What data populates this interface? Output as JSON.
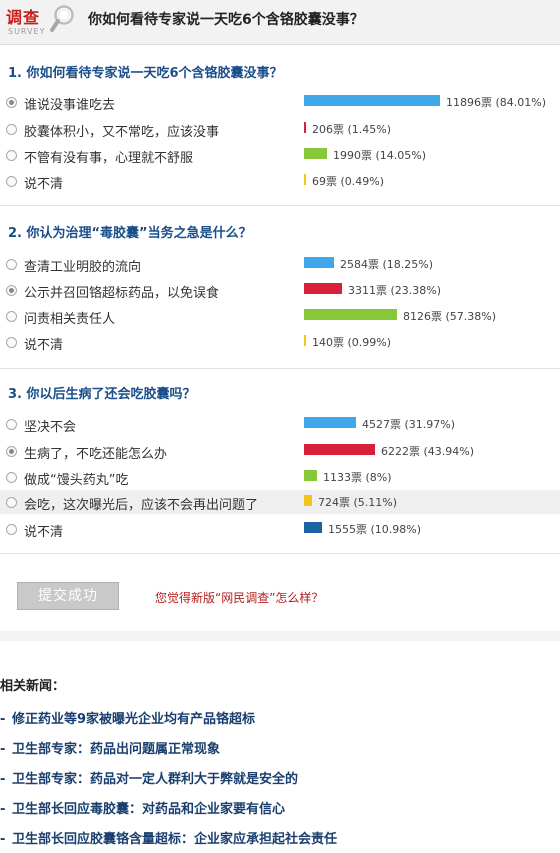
{
  "header": {
    "logo_cn": "调查",
    "logo_en": "SURVEY",
    "title": "你如何看待专家说一天吃6个含铬胶囊没事？"
  },
  "questions": [
    {
      "title": "1. 你如何看待专家说一天吃6个含铬胶囊没事？",
      "options": [
        {
          "label": "谁说没事谁吃去",
          "result": "11896票 (84.01%)",
          "percent": 84.01,
          "color": "#3fa7e8",
          "selected": true
        },
        {
          "label": "胶囊体积小，又不常吃，应该没事",
          "result": "206票 (1.45%)",
          "percent": 1.45,
          "color": "#d9203a",
          "selected": false
        },
        {
          "label": "不管有没有事，心理就不舒服",
          "result": "1990票 (14.05%)",
          "percent": 14.05,
          "color": "#86c83a",
          "selected": false
        },
        {
          "label": "说不清",
          "result": "69票 (0.49%)",
          "percent": 0.49,
          "color": "#f5c31d",
          "selected": false
        }
      ]
    },
    {
      "title": "2. 你认为治理“毒胶囊”当务之急是什么？",
      "options": [
        {
          "label": "查清工业明胶的流向",
          "result": "2584票 (18.25%)",
          "percent": 18.25,
          "color": "#3fa7e8",
          "selected": false
        },
        {
          "label": "公示并召回铬超标药品，以免误食",
          "result": "3311票 (23.38%)",
          "percent": 23.38,
          "color": "#d9203a",
          "selected": true
        },
        {
          "label": "问责相关责任人",
          "result": "8126票 (57.38%)",
          "percent": 57.38,
          "color": "#86c83a",
          "selected": false
        },
        {
          "label": "说不清",
          "result": "140票 (0.99%)",
          "percent": 0.99,
          "color": "#f5c31d",
          "selected": false
        }
      ]
    },
    {
      "title": "3. 你以后生病了还会吃胶囊吗？",
      "options": [
        {
          "label": "坚决不会",
          "result": "4527票 (31.97%)",
          "percent": 31.97,
          "color": "#3fa7e8",
          "selected": false
        },
        {
          "label": "生病了，不吃还能怎么办",
          "result": "6222票 (43.94%)",
          "percent": 43.94,
          "color": "#d9203a",
          "selected": true
        },
        {
          "label": "做成“馒头药丸”吃",
          "result": "1133票 (8%)",
          "percent": 8,
          "color": "#86c83a",
          "selected": false
        },
        {
          "label": "会吃，这次曝光后，应该不会再出问题了",
          "result": "724票 (5.11%)",
          "percent": 5.11,
          "color": "#f5c31d",
          "selected": false
        },
        {
          "label": "说不清",
          "result": "1555票 (10.98%)",
          "percent": 10.98,
          "color": "#1b63a3",
          "selected": false
        }
      ]
    }
  ],
  "actions": {
    "submit_label": "提交成功",
    "feedback_link": "您觉得新版“网民调查”怎么样？"
  },
  "related": {
    "title": "相关新闻：",
    "items": [
      "修正药业等9家被曝光企业均有产品铬超标",
      "卫生部专家：药品出问题属正常现象",
      "卫生部专家：药品对一定人群利大于弊就是安全的",
      "卫生部长回应毒胶囊：对药品和企业家要有信心",
      "卫生部长回应胶囊铬含量超标：企业家应承担起社会责任"
    ]
  }
}
